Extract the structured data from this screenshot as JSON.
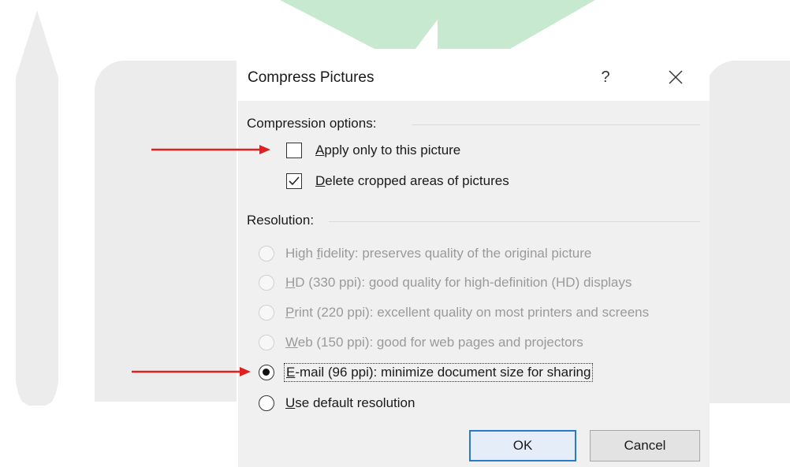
{
  "dialog": {
    "title": "Compress Pictures",
    "help_label": "?",
    "compression_options_label": "Compression options:",
    "checkboxes": [
      {
        "pre": "",
        "accel": "A",
        "post": "pply only to this picture",
        "checked": false
      },
      {
        "pre": "",
        "accel": "D",
        "post": "elete cropped areas of pictures",
        "checked": true
      }
    ],
    "resolution_label": "Resolution:",
    "radios": [
      {
        "pre": "High ",
        "accel": "f",
        "post": "idelity: preserves quality of the original picture",
        "disabled": true,
        "selected": false
      },
      {
        "pre": "",
        "accel": "H",
        "post": "D (330 ppi): good quality for high-definition (HD) displays",
        "disabled": true,
        "selected": false
      },
      {
        "pre": "",
        "accel": "P",
        "post": "rint (220 ppi): excellent quality on most printers and screens",
        "disabled": true,
        "selected": false
      },
      {
        "pre": "",
        "accel": "W",
        "post": "eb (150 ppi): good for web pages and projectors",
        "disabled": true,
        "selected": false
      },
      {
        "pre": "",
        "accel": "E",
        "post": "-mail (96 ppi): minimize document size for sharing",
        "disabled": false,
        "selected": true
      },
      {
        "pre": "",
        "accel": "U",
        "post": "se default resolution",
        "disabled": false,
        "selected": false
      }
    ],
    "ok_label": "OK",
    "cancel_label": "Cancel"
  },
  "colors": {
    "accent_blue": "#2b79c9",
    "arrow_red": "#e02020",
    "green_shape": "#c6e9cf",
    "gray_shape": "#ececec"
  }
}
